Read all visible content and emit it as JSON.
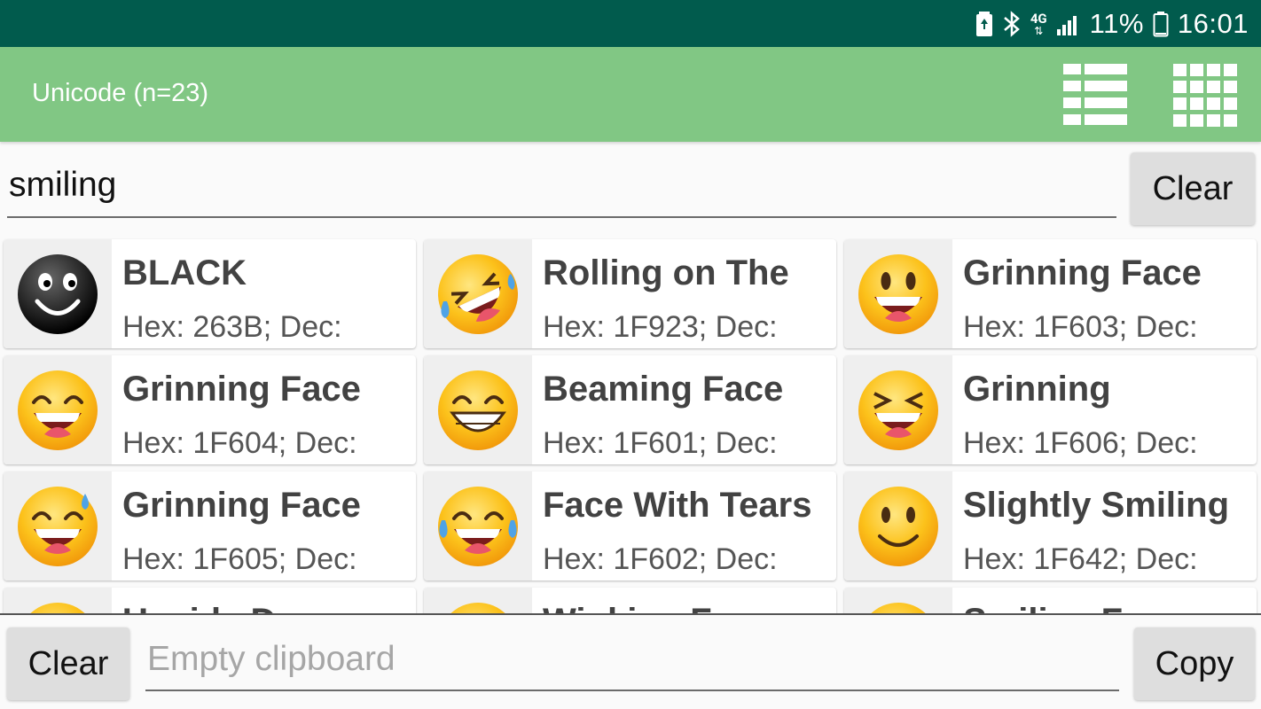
{
  "status_bar": {
    "network_label": "4G",
    "battery_percent": "11%",
    "time": "16:01"
  },
  "app_bar": {
    "title": "Unicode (n=23)",
    "icons": [
      "view-list-icon",
      "view-grid-icon"
    ]
  },
  "search": {
    "value": "smiling",
    "clear_label": "Clear"
  },
  "results": [
    {
      "name": "BLACK",
      "code": "Hex: 263B; Dec:",
      "emoji": "black-smiling-face"
    },
    {
      "name": "Rolling on The",
      "code": "Hex: 1F923; Dec:",
      "emoji": "rofl"
    },
    {
      "name": "Grinning Face",
      "code": "Hex: 1F603; Dec:",
      "emoji": "grinning-big-eyes"
    },
    {
      "name": "Grinning Face",
      "code": "Hex: 1F604; Dec:",
      "emoji": "grinning-smiling-eyes"
    },
    {
      "name": "Beaming Face",
      "code": "Hex: 1F601; Dec:",
      "emoji": "beaming"
    },
    {
      "name": "Grinning",
      "code": "Hex: 1F606; Dec:",
      "emoji": "squinting"
    },
    {
      "name": "Grinning Face",
      "code": "Hex: 1F605; Dec:",
      "emoji": "sweat-smile"
    },
    {
      "name": "Face With Tears",
      "code": "Hex: 1F602; Dec:",
      "emoji": "tears-of-joy"
    },
    {
      "name": "Slightly Smiling",
      "code": "Hex: 1F642; Dec:",
      "emoji": "slightly-smiling"
    },
    {
      "name": "Upside Down",
      "code": "",
      "emoji": "partial"
    },
    {
      "name": "Winking Face",
      "code": "",
      "emoji": "partial"
    },
    {
      "name": "Smiling Face",
      "code": "",
      "emoji": "partial"
    }
  ],
  "clipboard": {
    "clear_label": "Clear",
    "placeholder": "Empty clipboard",
    "copy_label": "Copy"
  }
}
